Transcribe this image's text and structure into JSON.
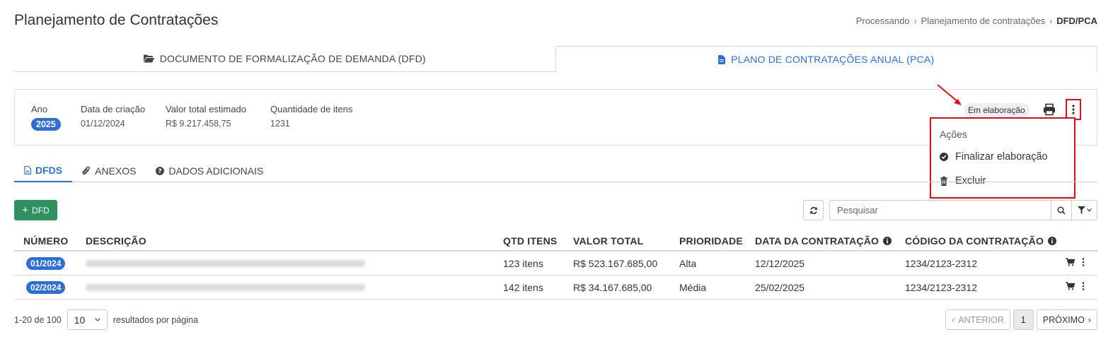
{
  "page": {
    "title": "Planejamento de Contratações"
  },
  "breadcrumb": {
    "items": [
      "Processando",
      "Planejamento de contratações",
      "DFD/PCA"
    ]
  },
  "top_tabs": [
    {
      "label": "DOCUMENTO DE FORMALIZAÇÃO DE DEMANDA (DFD)",
      "icon": "folder-open-icon",
      "active": false
    },
    {
      "label": "PLANO DE CONTRATAÇÕES ANUAL (PCA)",
      "icon": "file-icon",
      "active": true
    }
  ],
  "summary": {
    "year_label": "Ano",
    "year_value": "2025",
    "created_label": "Data de criação",
    "created_value": "01/12/2024",
    "total_label": "Valor total estimado",
    "total_value": "R$ 9.217.458,75",
    "qty_label": "Quantidade de itens",
    "qty_value": "1231"
  },
  "status": {
    "label": "Em elaboração"
  },
  "actions_menu": {
    "header": "Ações",
    "items": [
      {
        "label": "Finalizar elaboração",
        "icon": "check-circle-icon"
      },
      {
        "label": "Excluir",
        "icon": "trash-icon"
      }
    ]
  },
  "sub_tabs": [
    {
      "label": "DFDS",
      "icon": "file-icon",
      "active": true
    },
    {
      "label": "ANEXOS",
      "icon": "paperclip-icon",
      "active": false
    },
    {
      "label": "DADOS ADICIONAIS",
      "icon": "question-circle-icon",
      "active": false
    }
  ],
  "toolbar": {
    "add_label": "DFD",
    "search_placeholder": "Pesquisar"
  },
  "table": {
    "headers": [
      "NÚMERO",
      "DESCRIÇÃO",
      "QTD ITENS",
      "VALOR TOTAL",
      "PRIORIDADE",
      "DATA DA CONTRATAÇÃO",
      "CÓDIGO DA CONTRATAÇÃO"
    ],
    "rows": [
      {
        "numero": "01/2024",
        "qtd": "123 itens",
        "valor": "R$ 523.167.685,00",
        "prioridade": "Alta",
        "data": "12/12/2025",
        "codigo": "1234/2123-2312"
      },
      {
        "numero": "02/2024",
        "qtd": "142 itens",
        "valor": "R$ 34.167.685,00",
        "prioridade": "Média",
        "data": "25/02/2025",
        "codigo": "1234/2123-2312"
      }
    ]
  },
  "footer": {
    "range": "1-20 de 100",
    "per_page": "10",
    "per_page_label": "resultados por página",
    "prev_label": "ANTERIOR",
    "current_page": "1",
    "next_label": "PRÓXIMO"
  },
  "colors": {
    "accent": "#2f6fd4",
    "success": "#2f9161",
    "highlight": "#e0101a"
  }
}
